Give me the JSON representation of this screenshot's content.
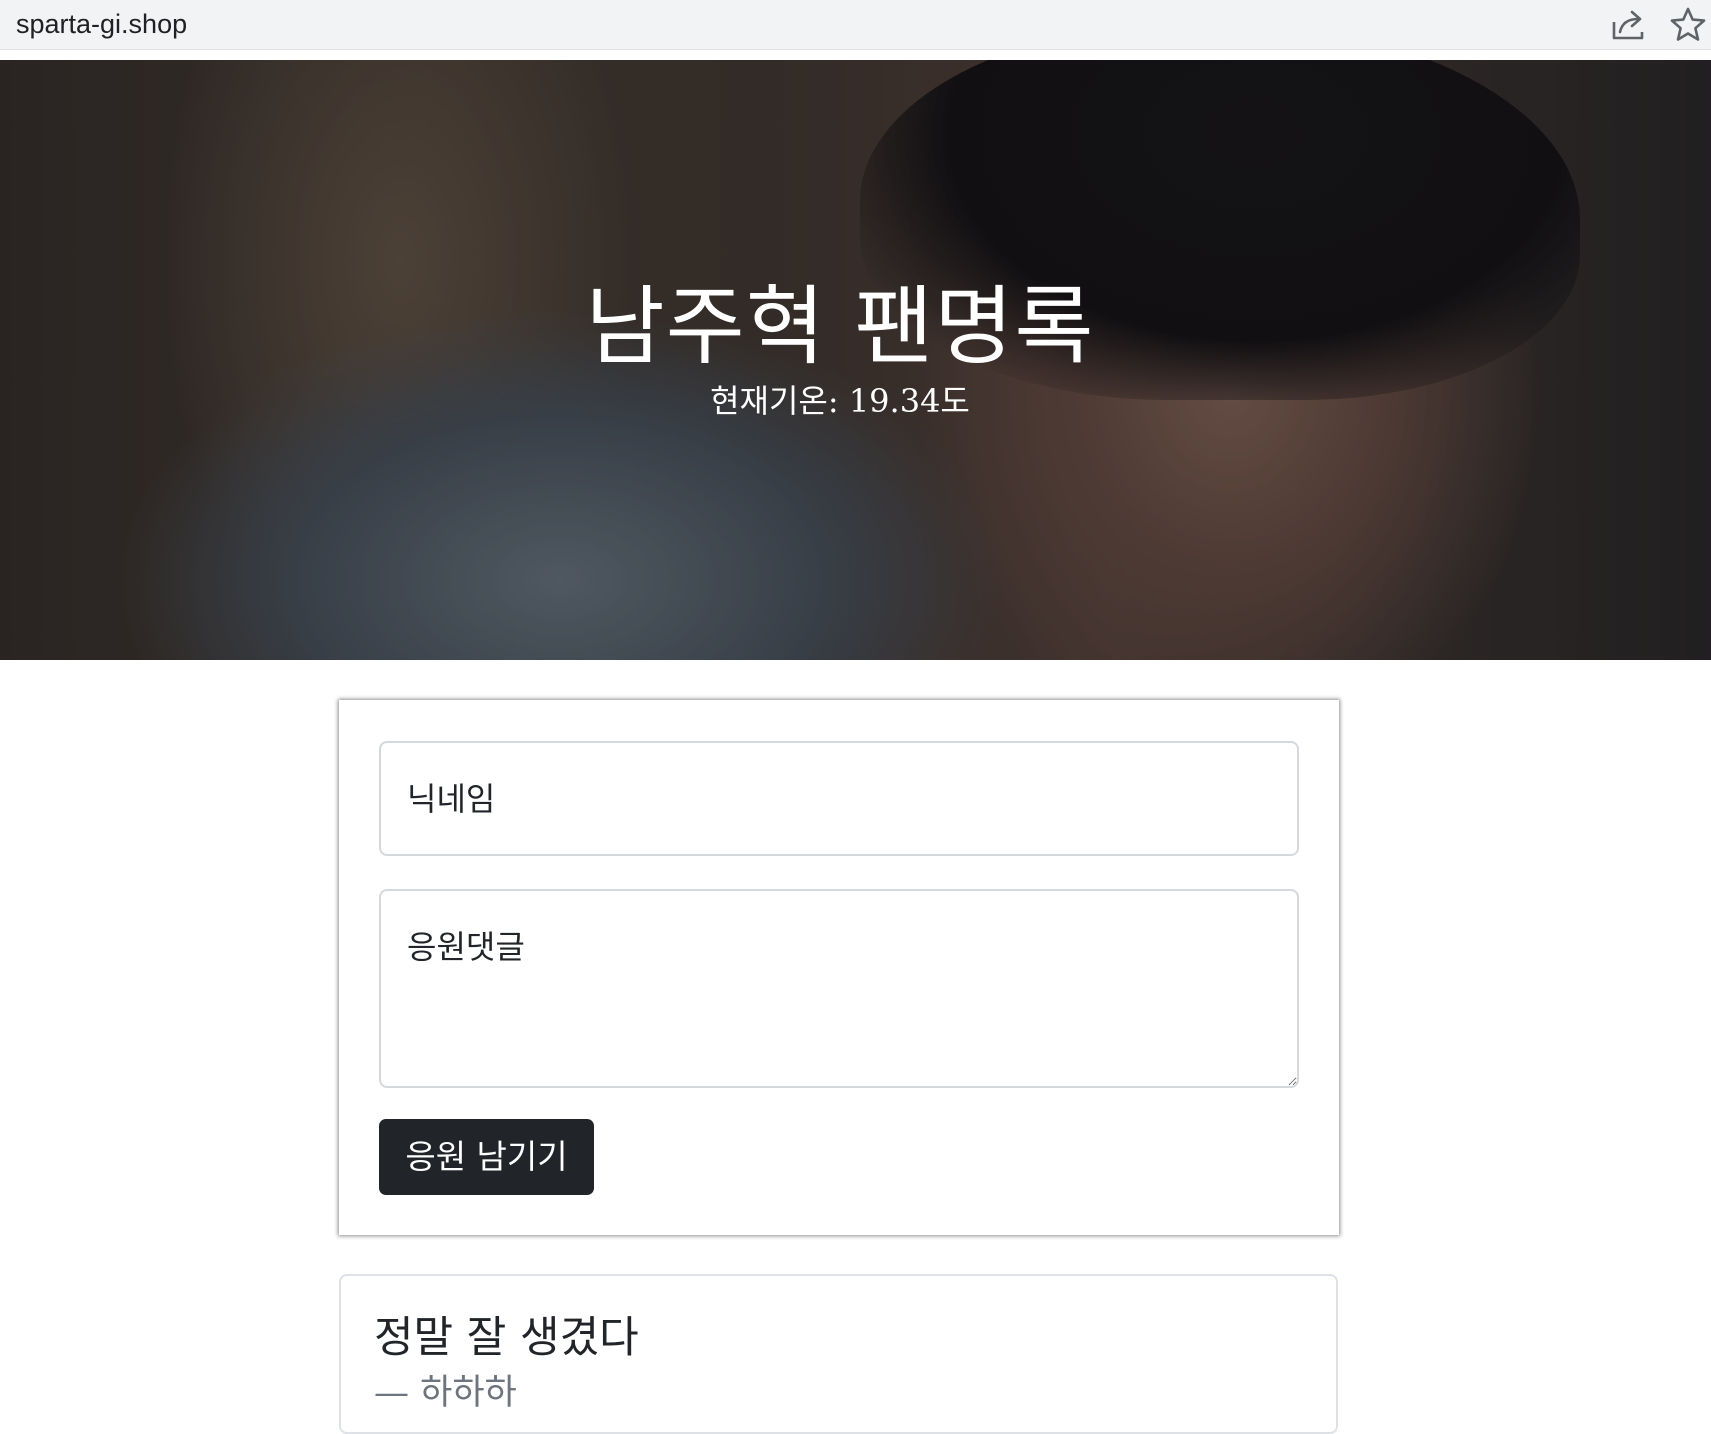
{
  "browser": {
    "url": "sparta-gi.shop",
    "icons": [
      "share-icon",
      "bookmark-star-icon"
    ]
  },
  "hero": {
    "title": "남주혁 팬명록",
    "temperature": "현재기온: 19.34도"
  },
  "form": {
    "nickname_placeholder": "닉네임",
    "comment_placeholder": "응원댓글",
    "submit_label": "응원 남기기"
  },
  "comments": [
    {
      "text": "정말 잘 생겼다",
      "author": "— 하하하"
    }
  ],
  "colors": {
    "button_bg": "#212529",
    "text_dark": "#212529",
    "text_muted": "#6c757d"
  }
}
